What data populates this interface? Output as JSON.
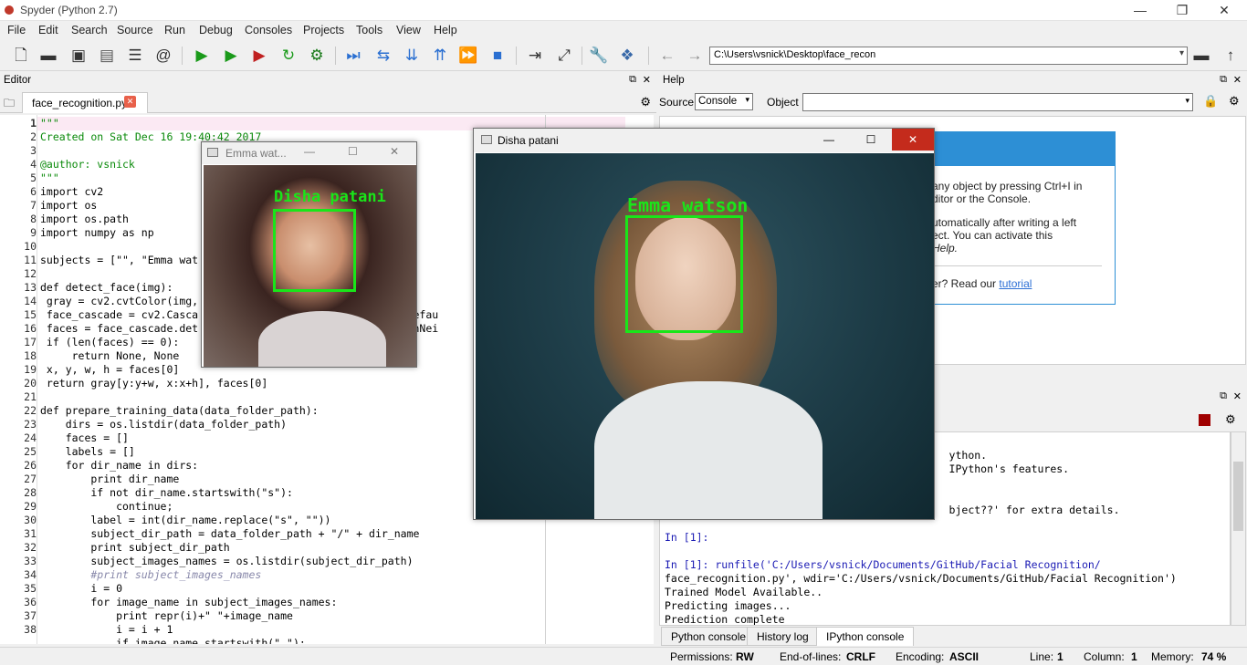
{
  "window": {
    "title": "Spyder (Python 2.7)",
    "minimize": "—",
    "maximize": "❐",
    "close": "✕"
  },
  "menu": [
    "File",
    "Edit",
    "Search",
    "Source",
    "Run",
    "Debug",
    "Consoles",
    "Projects",
    "Tools",
    "View",
    "Help"
  ],
  "toolbar": {
    "path": "C:\\Users\\vsnick\\Desktop\\face_recon",
    "icons": [
      "new-file-icon",
      "open-folder-icon",
      "save-icon",
      "save-all-icon",
      "outline-icon",
      "at-icon",
      "run-icon",
      "run-cell-icon",
      "run-cell-advance-icon",
      "rerun-icon",
      "debug-config-icon",
      "debug-step-icon",
      "debug-next-icon",
      "debug-into-icon",
      "debug-return-icon",
      "debug-continue-icon",
      "debug-stop-icon",
      "maximize-pane-icon",
      "fullscreen-icon",
      "wrench-icon",
      "python-path-icon",
      "back-arrow-icon",
      "forward-arrow-icon",
      "browse-folder-icon",
      "parent-dir-icon"
    ]
  },
  "editor": {
    "pane_title": "Editor",
    "tab_label": "face_recognition.py",
    "lines": [
      {
        "n": "1",
        "t": "\"\"\""
      },
      {
        "n": "2",
        "t": "Created on Sat Dec 16 19:40:42 2017"
      },
      {
        "n": "3",
        "t": ""
      },
      {
        "n": "4",
        "t": "@author: vsnick"
      },
      {
        "n": "5",
        "t": "\"\"\""
      },
      {
        "n": "6",
        "t": "import cv2"
      },
      {
        "n": "7",
        "t": "import os"
      },
      {
        "n": "8",
        "t": "import os.path"
      },
      {
        "n": "9",
        "t": "import numpy as np"
      },
      {
        "n": "10",
        "t": ""
      },
      {
        "n": "11",
        "t": "subjects = [\"\", \"Emma wat"
      },
      {
        "n": "12",
        "t": ""
      },
      {
        "n": "13",
        "t": "def detect_face(img):"
      },
      {
        "n": "14",
        "t": " gray = cv2.cvtColor(img,"
      },
      {
        "n": "15",
        "t": " face_cascade = cv2.Casca                             ace_defau"
      },
      {
        "n": "16",
        "t": " faces = face_cascade.det                             2, minNei"
      },
      {
        "n": "17",
        "t": " if (len(faces) == 0):"
      },
      {
        "n": "18",
        "t": "     return None, None"
      },
      {
        "n": "19",
        "t": " x, y, w, h = faces[0]"
      },
      {
        "n": "20",
        "t": " return gray[y:y+w, x:x+h], faces[0]"
      },
      {
        "n": "21",
        "t": ""
      },
      {
        "n": "22",
        "t": "def prepare_training_data(data_folder_path):"
      },
      {
        "n": "23",
        "t": "    dirs = os.listdir(data_folder_path)"
      },
      {
        "n": "24",
        "t": "    faces = []"
      },
      {
        "n": "25",
        "t": "    labels = []"
      },
      {
        "n": "26",
        "t": "    for dir_name in dirs:"
      },
      {
        "n": "27",
        "t": "        print dir_name"
      },
      {
        "n": "28",
        "t": "        if not dir_name.startswith(\"s\"):"
      },
      {
        "n": "29",
        "t": "            continue;"
      },
      {
        "n": "30",
        "t": "        label = int(dir_name.replace(\"s\", \"\"))"
      },
      {
        "n": "31",
        "t": "        subject_dir_path = data_folder_path + \"/\" + dir_name"
      },
      {
        "n": "32",
        "t": "        print subject_dir_path"
      },
      {
        "n": "33",
        "t": "        subject_images_names = os.listdir(subject_dir_path)"
      },
      {
        "n": "34",
        "t": "        #print subject_images_names"
      },
      {
        "n": "35",
        "t": "        i = 0"
      },
      {
        "n": "36",
        "t": "        for image_name in subject_images_names:"
      },
      {
        "n": "37",
        "t": "            print repr(i)+\" \"+image_name"
      },
      {
        "n": "38",
        "t": "            i = i + 1"
      },
      {
        "n": "",
        "t": "            if image_name.startswith(\".\"):"
      }
    ]
  },
  "help": {
    "pane_title": "Help",
    "source_label": "Source",
    "source_value": "Console",
    "object_label": "Object",
    "card_lines": [
      "any object by pressing Ctrl+I in",
      "ditor or the Console.",
      "",
      "utomatically after writing a left",
      "ect. You can activate this",
      "Help."
    ],
    "card_footer_prefix": "er? Read our ",
    "card_footer_link": "tutorial"
  },
  "console": {
    "lines": [
      "                                             ython.",
      "                                             IPython's features.",
      "",
      "",
      "                                             bject??' for extra details.",
      "",
      "In [1]:",
      "",
      "In [1]: runfile('C:/Users/vsnick/Documents/GitHub/Facial Recognition/",
      "face_recognition.py', wdir='C:/Users/vsnick/Documents/GitHub/Facial Recognition')",
      "Trained Model Available..",
      "Predicting images...",
      "Prediction complete"
    ],
    "tabs": [
      "Python console",
      "History log",
      "IPython console"
    ]
  },
  "status": {
    "permissions_label": "Permissions:",
    "permissions": "RW",
    "eol_label": "End-of-lines:",
    "eol": "CRLF",
    "encoding_label": "Encoding:",
    "encoding": "ASCII",
    "line_label": "Line:",
    "line": "1",
    "column_label": "Column:",
    "column": "1",
    "memory_label": "Memory:",
    "memory": "74 %"
  },
  "windows": {
    "small": {
      "title": "Emma wat...",
      "face_label": "Disha patani"
    },
    "large": {
      "title": "Disha patani",
      "face_label": "Emma watson"
    }
  },
  "colors": {
    "detection_box": "#19e619",
    "help_accent": "#2d8fd5",
    "stop_red": "#b00000"
  }
}
